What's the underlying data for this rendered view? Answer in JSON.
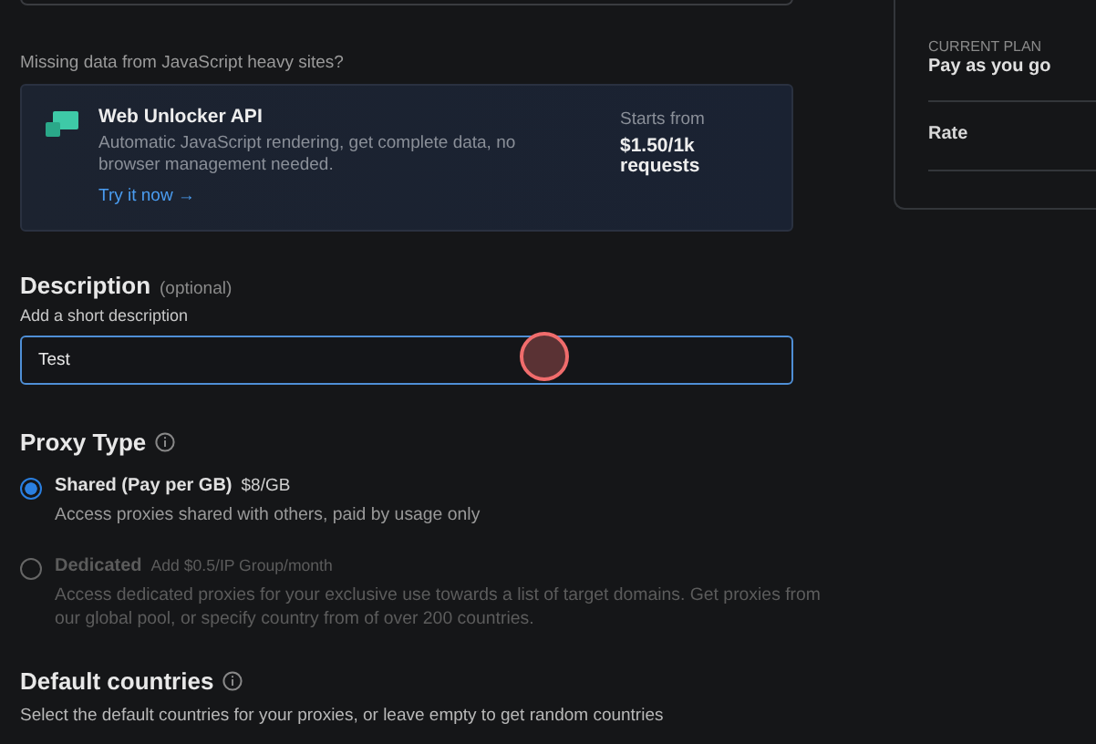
{
  "promo": {
    "question": "Missing data from JavaScript heavy sites?",
    "title": "Web Unlocker API",
    "description": "Automatic JavaScript rendering, get complete data, no browser management needed.",
    "link": "Try it now →",
    "price_label": "Starts from",
    "price": "$1.50/1k requests"
  },
  "description": {
    "title": "Description",
    "optional": "(optional)",
    "hint": "Add a short description",
    "value": "Test",
    "focused": true
  },
  "proxy_type": {
    "title": "Proxy Type",
    "options": [
      {
        "label": "Shared (Pay per GB)",
        "price": "$8/GB",
        "description": "Access proxies shared with others, paid by usage only",
        "selected": true
      },
      {
        "label": "Dedicated",
        "price": "Add $0.5/IP Group/month",
        "description": "Access dedicated proxies for your exclusive use towards a list of target domains. Get proxies from our global pool, or specify country from of over 200 countries.",
        "selected": false
      }
    ]
  },
  "default_countries": {
    "title": "Default countries",
    "description": "Select the default countries for your proxies, or leave empty to get random countries"
  },
  "plan_panel": {
    "current_plan_label": "CURRENT PLAN",
    "current_plan": "Pay as you go",
    "rate_label": "Rate"
  }
}
